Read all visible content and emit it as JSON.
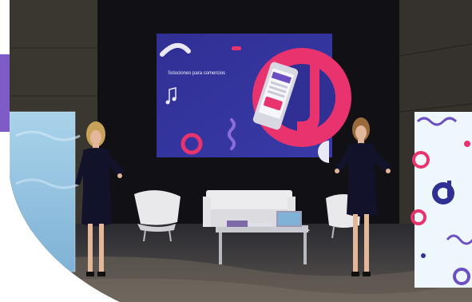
{
  "screen": {
    "caption": "Soluciones para comercios"
  },
  "colors": {
    "screen_bg": "#2f2a8f",
    "accent_pink": "#e8336f",
    "accent_purple": "#6d4fc4",
    "wall_dark": "#15151c",
    "brand_purple_block": "#7e5bc7"
  }
}
